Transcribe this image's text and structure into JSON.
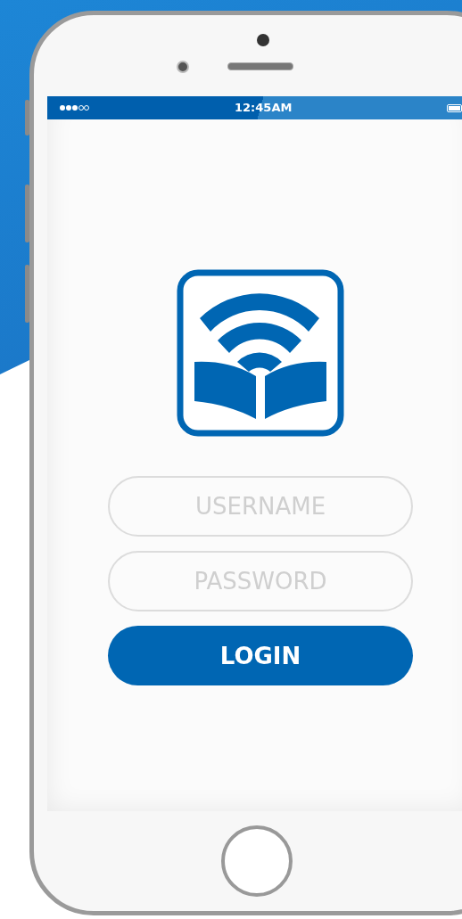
{
  "status_bar": {
    "time": "12:45AM"
  },
  "login_form": {
    "username": {
      "placeholder": "USERNAME"
    },
    "password": {
      "placeholder": "PASSWORD"
    },
    "submit": {
      "label": "LOGIN"
    }
  }
}
